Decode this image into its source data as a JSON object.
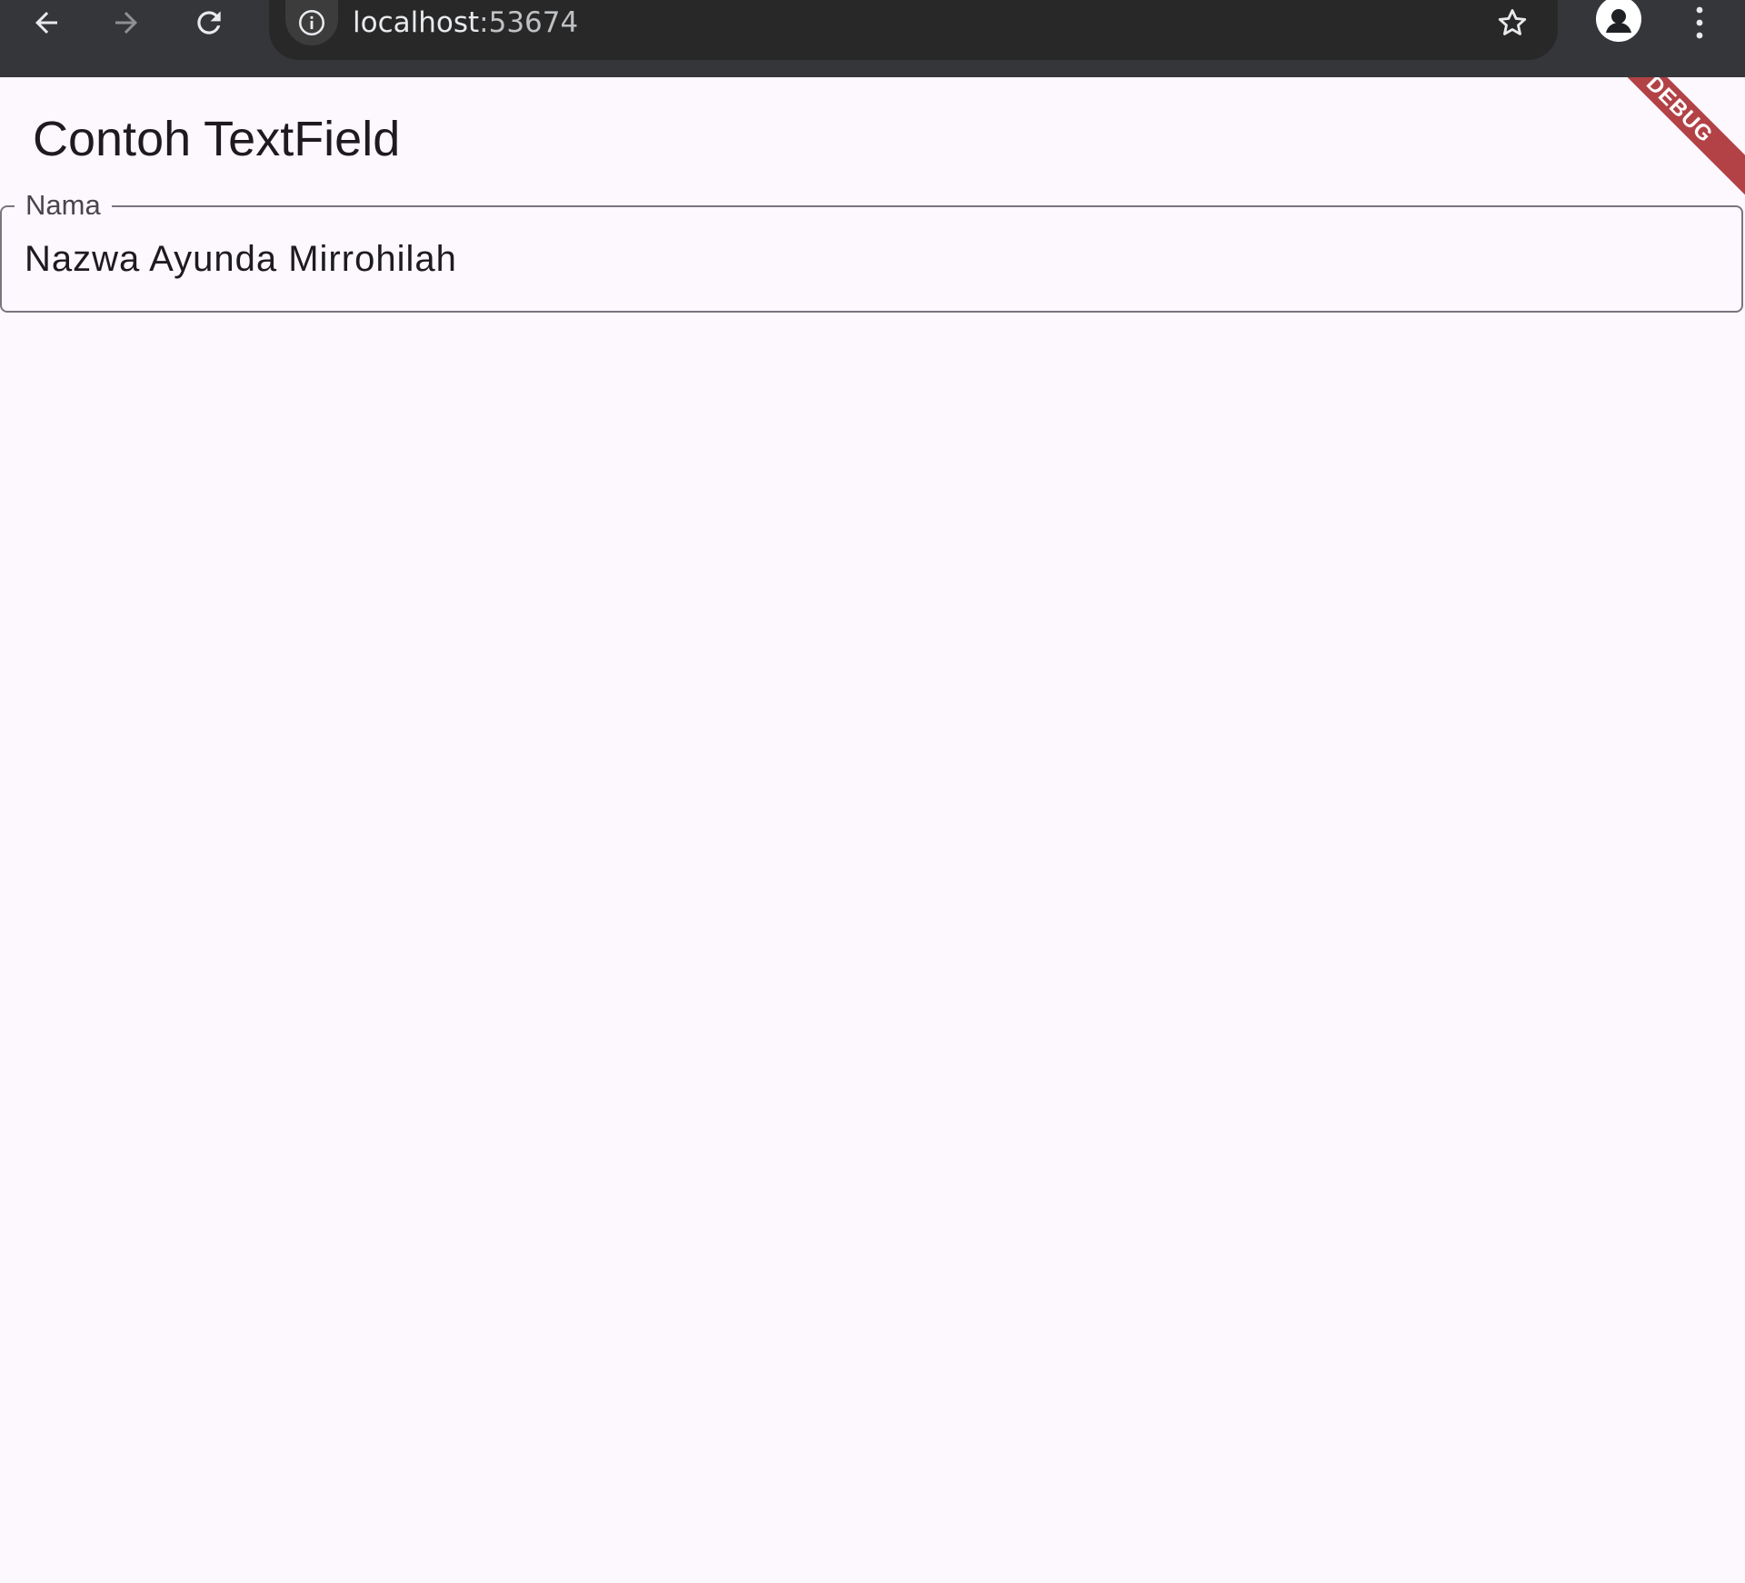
{
  "browser": {
    "url_host": "localhost",
    "url_port": ":53674",
    "icons": {
      "back": "arrow-left-icon",
      "forward": "arrow-right-icon",
      "reload": "reload-icon",
      "info": "info-icon",
      "bookmark": "star-icon",
      "profile": "person-icon",
      "menu": "kebab-menu-icon"
    }
  },
  "app": {
    "title": "Contoh TextField",
    "debug_banner": "DEBUG",
    "text_field": {
      "label": "Nama",
      "value": "Nazwa Ayunda Mirrohilah"
    }
  },
  "colors": {
    "toolbar": "#35363a",
    "omnibox": "#282828",
    "background": "#fdf7fe",
    "outline": "#79747e",
    "debug": "#a52226"
  }
}
